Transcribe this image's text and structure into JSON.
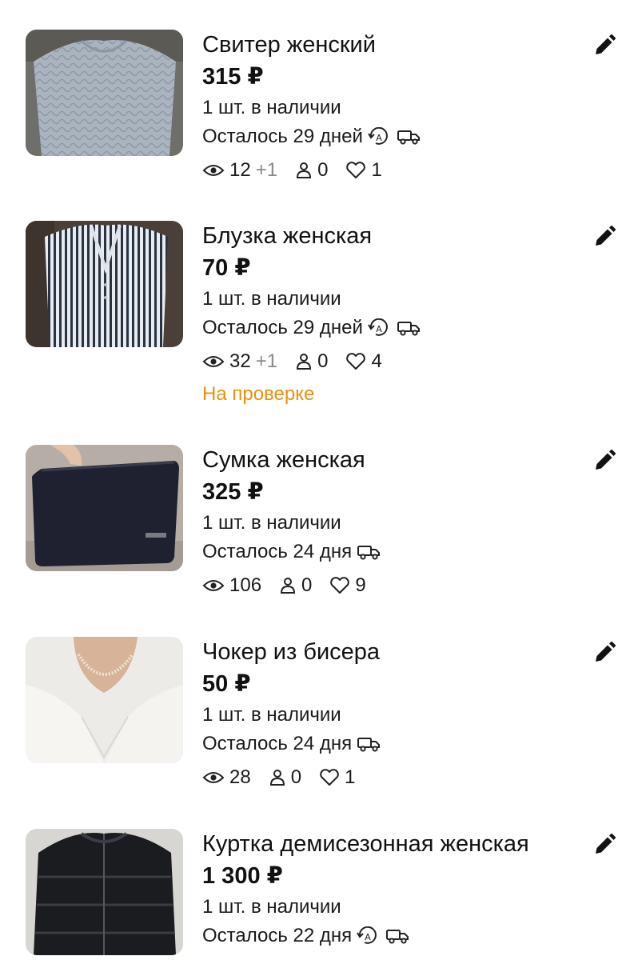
{
  "listings": [
    {
      "title": "Свитер женский",
      "price": "315 ₽",
      "stock": "1 шт. в наличии",
      "remaining": "Осталось 29 дней",
      "auto_renew": true,
      "delivery": true,
      "views": "12",
      "views_delta": "+1",
      "contacts": "0",
      "favorites": "1",
      "status": ""
    },
    {
      "title": "Блузка женская",
      "price": "70 ₽",
      "stock": "1 шт. в наличии",
      "remaining": "Осталось 29 дней",
      "auto_renew": true,
      "delivery": true,
      "views": "32",
      "views_delta": "+1",
      "contacts": "0",
      "favorites": "4",
      "status": "На проверке"
    },
    {
      "title": "Сумка женская",
      "price": "325 ₽",
      "stock": "1 шт. в наличии",
      "remaining": "Осталось 24 дня",
      "auto_renew": false,
      "delivery": true,
      "views": "106",
      "views_delta": "",
      "contacts": "0",
      "favorites": "9",
      "status": ""
    },
    {
      "title": "Чокер из бисера",
      "price": "50 ₽",
      "stock": "1 шт. в наличии",
      "remaining": "Осталось 24 дня",
      "auto_renew": false,
      "delivery": true,
      "views": "28",
      "views_delta": "",
      "contacts": "0",
      "favorites": "1",
      "status": ""
    },
    {
      "title": "Куртка демисезонная женская",
      "price": "1 300 ₽",
      "stock": "1 шт. в наличии",
      "remaining": "Осталось 22 дня",
      "auto_renew": true,
      "delivery": true,
      "views": "",
      "views_delta": "",
      "contacts": "",
      "favorites": "",
      "status": ""
    }
  ],
  "colors": {
    "status_pending": "#e8900c",
    "text": "#111111",
    "muted": "#8a8a8a"
  },
  "icons": {
    "edit": "pencil-icon",
    "auto_renew": "auto-renew-icon",
    "delivery": "delivery-truck-icon",
    "views": "eye-icon",
    "contacts": "person-icon",
    "favorites": "heart-icon"
  }
}
